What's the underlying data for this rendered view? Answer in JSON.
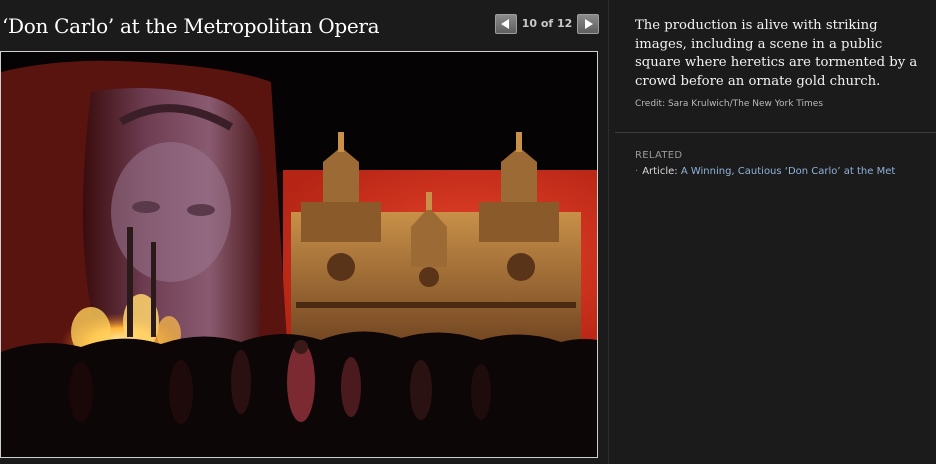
{
  "header": {
    "title": "‘Don Carlo’ at the Metropolitan Opera"
  },
  "nav": {
    "prev_icon": "arrow-left-icon",
    "next_icon": "arrow-right-icon",
    "counter": "10 of 12"
  },
  "photo": {
    "description_icon": "opera-stage-photo"
  },
  "sidebar": {
    "caption": "The production is alive with striking images, including a scene in a public square where heretics are tormented by a crowd before an ornate gold church.",
    "credit": "Credit: Sara Krulwich/The New York Times",
    "related_heading": "RELATED",
    "related_items": [
      {
        "prefix": "Article:",
        "link": "A Winning, Cautious ‘Don Carlo’ at the Met"
      }
    ]
  },
  "colors": {
    "background": "#1b1b1b",
    "link": "#8fb3d9",
    "stage_red": "#d4371f",
    "church_gold": "#a8743a"
  }
}
